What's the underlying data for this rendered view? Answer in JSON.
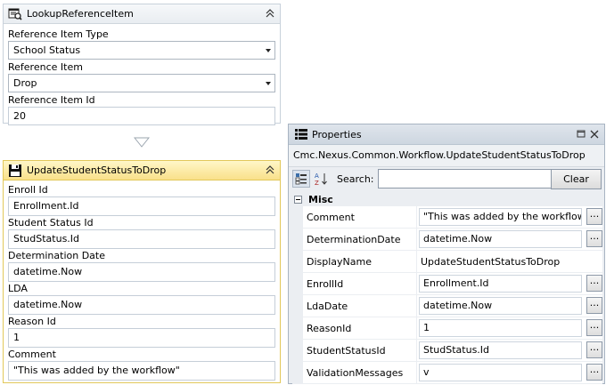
{
  "lookup_card": {
    "title": "LookupReferenceItem",
    "fields": [
      {
        "label": "Reference Item Type",
        "value": "School Status"
      },
      {
        "label": "Reference Item",
        "value": "Drop"
      },
      {
        "label": "Reference Item Id",
        "value": "20"
      }
    ]
  },
  "update_card": {
    "title": "UpdateStudentStatusToDrop",
    "fields": [
      {
        "label": "Enroll Id",
        "value": "Enrollment.Id"
      },
      {
        "label": "Student Status Id",
        "value": "StudStatus.Id"
      },
      {
        "label": "Determination Date",
        "value": "datetime.Now"
      },
      {
        "label": "LDA",
        "value": "datetime.Now"
      },
      {
        "label": "Reason Id",
        "value": "1"
      },
      {
        "label": "Comment",
        "value": "\"This was added by the workflow\""
      }
    ]
  },
  "properties": {
    "title": "Properties",
    "type_name": "Cmc.Nexus.Common.Workflow.UpdateStudentStatusToDrop",
    "search_label": "Search:",
    "search_value": "",
    "clear_label": "Clear",
    "category": "Misc",
    "ellipsis": "...",
    "rows": [
      {
        "name": "Comment",
        "value": "\"This was added by the workflow\""
      },
      {
        "name": "DeterminationDate",
        "value": "datetime.Now"
      },
      {
        "name": "DisplayName",
        "value": "UpdateStudentStatusToDrop"
      },
      {
        "name": "EnrollId",
        "value": "Enrollment.Id"
      },
      {
        "name": "LdaDate",
        "value": "datetime.Now"
      },
      {
        "name": "ReasonId",
        "value": "1"
      },
      {
        "name": "StudentStatusId",
        "value": "StudStatus.Id"
      },
      {
        "name": "ValidationMessages",
        "value": "v"
      }
    ]
  },
  "colors": {
    "selected_header": "#f9e08a",
    "panel_bg": "#ebeef2"
  }
}
